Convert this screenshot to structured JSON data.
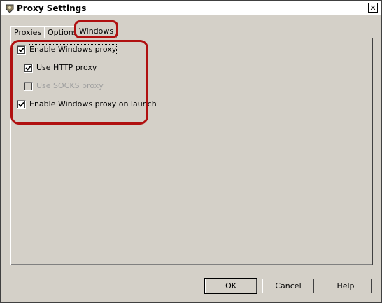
{
  "window": {
    "title": "Proxy Settings",
    "close_symbol": "✕"
  },
  "tabs": [
    {
      "label": "Proxies",
      "active": false
    },
    {
      "label": "Options",
      "active": false
    },
    {
      "label": "Windows",
      "active": true
    }
  ],
  "options": [
    {
      "label": "Enable Windows proxy",
      "checked": true,
      "enabled": true
    },
    {
      "label": "Use HTTP proxy",
      "checked": true,
      "enabled": true
    },
    {
      "label": "Use SOCKS proxy",
      "checked": false,
      "enabled": false
    },
    {
      "label": "Enable Windows proxy on launch",
      "checked": true,
      "enabled": true
    }
  ],
  "buttons": {
    "ok": "OK",
    "cancel": "Cancel",
    "help": "Help"
  },
  "colors": {
    "highlight": "#b01010",
    "face": "#d4d0c8"
  }
}
